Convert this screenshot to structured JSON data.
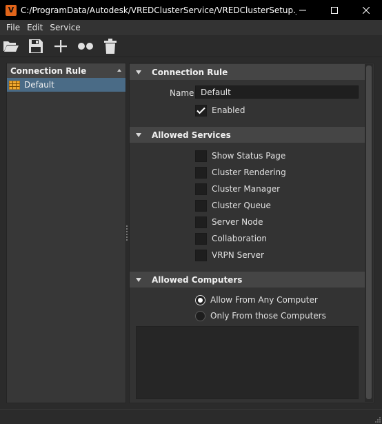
{
  "window": {
    "app_icon_letter": "V",
    "title": "C:/ProgramData/Autodesk/VREDClusterService/VREDClusterSetup.json ...",
    "minimize_icon": "minimize-icon",
    "maximize_icon": "maximize-icon",
    "close_icon": "close-icon"
  },
  "menu": {
    "items": [
      "File",
      "Edit",
      "Service"
    ]
  },
  "toolbar": {
    "buttons": [
      "open-folder-icon",
      "save-icon",
      "add-icon",
      "cluster-nodes-icon",
      "delete-icon"
    ]
  },
  "rules_panel": {
    "header": "Connection Rule",
    "items": [
      {
        "label": "Default",
        "icon": "table-icon",
        "selected": true
      }
    ]
  },
  "sections": {
    "connection_rule": {
      "title": "Connection Rule",
      "name_label": "Name",
      "name_value": "Default",
      "enabled_label": "Enabled",
      "enabled_checked": true
    },
    "allowed_services": {
      "title": "Allowed Services",
      "items": [
        {
          "label": "Show Status Page",
          "checked": false
        },
        {
          "label": "Cluster Rendering",
          "checked": false
        },
        {
          "label": "Cluster Manager",
          "checked": false
        },
        {
          "label": "Cluster Queue",
          "checked": false
        },
        {
          "label": "Server Node",
          "checked": false
        },
        {
          "label": "Collaboration",
          "checked": false
        },
        {
          "label": "VRPN Server",
          "checked": false
        }
      ]
    },
    "allowed_computers": {
      "title": "Allowed Computers",
      "options": [
        {
          "label": "Allow From Any Computer",
          "checked": true
        },
        {
          "label": "Only From those Computers",
          "checked": false
        }
      ]
    }
  },
  "colors": {
    "background": "#2b2b2b",
    "selection": "#4a6b86",
    "app_icon": "#e2651a",
    "section_header": "#454545"
  }
}
